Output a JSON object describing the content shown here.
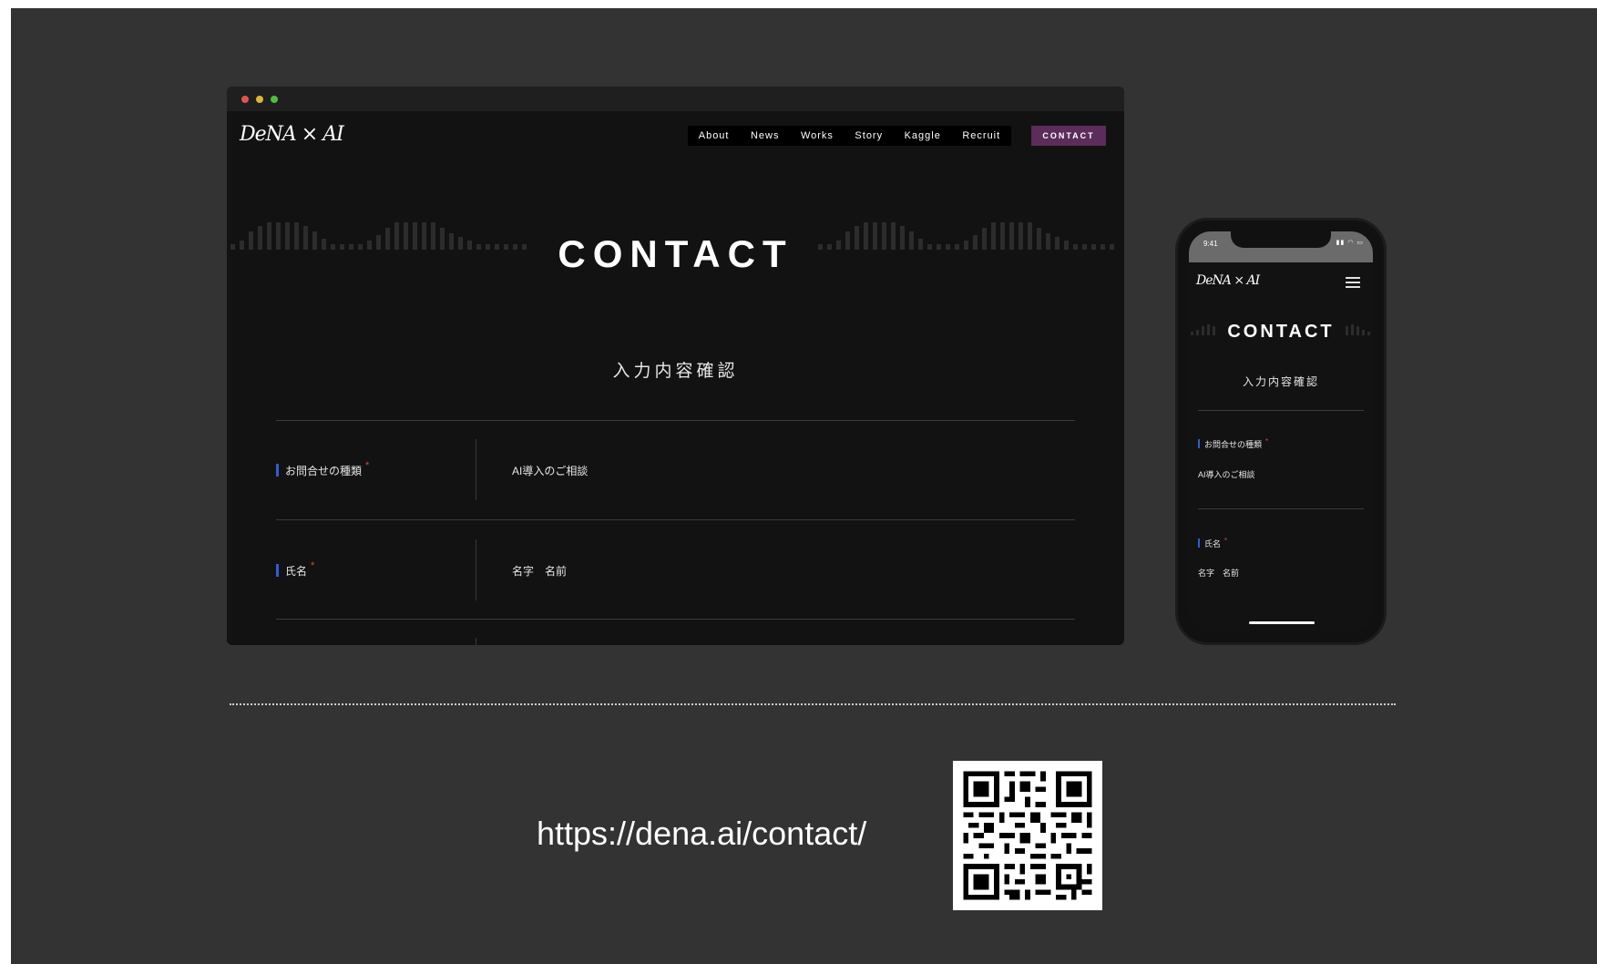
{
  "desktop": {
    "logo": "DeNA × AI",
    "nav": [
      "About",
      "News",
      "Works",
      "Story",
      "Kaggle",
      "Recruit"
    ],
    "contact_button": "CONTACT",
    "hero_title": "CONTACT",
    "confirm_heading": "入力内容確認",
    "fields": [
      {
        "label": "お問合せの種類",
        "required": "*",
        "value": "AI導入のご相談"
      },
      {
        "label": "氏名",
        "required": "*",
        "value": "名字　名前"
      }
    ]
  },
  "mobile": {
    "time": "9:41",
    "logo": "DeNA × AI",
    "hero_title": "CONTACT",
    "confirm_heading": "入力内容確認",
    "fields": [
      {
        "label": "お問合せの種類",
        "required": "*",
        "value": "AI導入のご相談"
      },
      {
        "label": "氏名",
        "required": "*",
        "value": "名字　名前"
      }
    ]
  },
  "footer": {
    "url": "https://dena.ai/contact/"
  },
  "colors": {
    "slide_bg": "#333333",
    "contact_button_bg": "#5c2c5b",
    "label_accent": "#2f5fd6",
    "required_mark": "#e0443e"
  }
}
